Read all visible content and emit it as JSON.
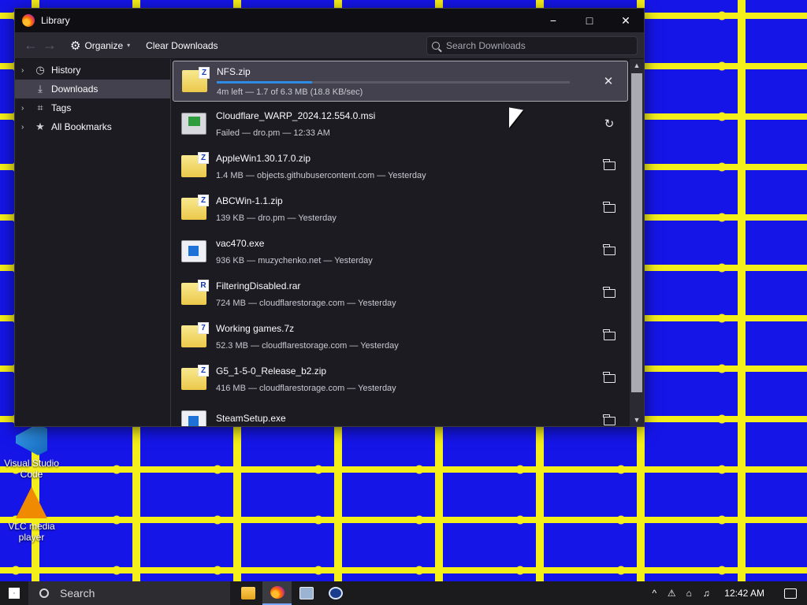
{
  "desktop": {
    "icons": [
      {
        "label": "Visual Studio Code",
        "icon": "vscode-icon"
      },
      {
        "label": "VLC media player",
        "icon": "vlc-icon"
      }
    ]
  },
  "window": {
    "title": "Library",
    "controls": {
      "minimize": "−",
      "maximize": "□",
      "close": "✕"
    }
  },
  "toolbar": {
    "back": "←",
    "forward": "→",
    "organize": "Organize",
    "clear_downloads": "Clear Downloads",
    "search_placeholder": "Search Downloads"
  },
  "sidebar": {
    "items": [
      {
        "label": "History",
        "icon": "clock-icon",
        "expandable": true,
        "active": false
      },
      {
        "label": "Downloads",
        "icon": "download-icon",
        "expandable": false,
        "active": true
      },
      {
        "label": "Tags",
        "icon": "tag-icon",
        "expandable": true,
        "active": false
      },
      {
        "label": "All Bookmarks",
        "icon": "star-icon",
        "expandable": true,
        "active": false
      }
    ]
  },
  "downloads": [
    {
      "name": "NFS.zip",
      "status": "4m left — 1.7 of 6.3 MB (18.8 KB/sec)",
      "progress": 0.27,
      "file_type": "zip",
      "action_icon": "cancel-icon"
    },
    {
      "name": "Cloudflare_WARP_2024.12.554.0.msi",
      "status": "Failed — dro.pm — 12:33 AM",
      "file_type": "msi",
      "action_icon": "retry-icon"
    },
    {
      "name": "AppleWin1.30.17.0.zip",
      "status": "1.4 MB — objects.githubusercontent.com — Yesterday",
      "file_type": "zip",
      "action_icon": "folder-icon"
    },
    {
      "name": "ABCWin-1.1.zip",
      "status": "139 KB — dro.pm — Yesterday",
      "file_type": "zip",
      "action_icon": "folder-icon"
    },
    {
      "name": "vac470.exe",
      "status": "936 KB — muzychenko.net — Yesterday",
      "file_type": "exe",
      "action_icon": "folder-icon"
    },
    {
      "name": "FilteringDisabled.rar",
      "status": "724 MB — cloudflarestorage.com — Yesterday",
      "file_type": "rar",
      "action_icon": "folder-icon"
    },
    {
      "name": "Working games.7z",
      "status": "52.3 MB — cloudflarestorage.com — Yesterday",
      "file_type": "7z",
      "action_icon": "folder-icon"
    },
    {
      "name": "G5_1-5-0_Release_b2.zip",
      "status": "416 MB — cloudflarestorage.com — Yesterday",
      "file_type": "zip",
      "action_icon": "folder-icon"
    },
    {
      "name": "SteamSetup.exe",
      "status": "",
      "file_type": "exe",
      "action_icon": "folder-icon"
    }
  ],
  "taskbar": {
    "search_text": "Search",
    "apps": [
      {
        "name": "file-explorer-icon",
        "active": false
      },
      {
        "name": "firefox-icon",
        "active": true
      },
      {
        "name": "network-app-icon",
        "active": false
      },
      {
        "name": "steam-icon",
        "active": false
      }
    ],
    "tray": {
      "chevron": "^",
      "clock": "12:42 AM"
    }
  },
  "colors": {
    "window_bg": "#1c1b22",
    "selected_item": "#42414d",
    "progress_accent": "#2c8ce6",
    "desktop_blue": "#1515e8",
    "desktop_yellow": "#f4ee1a"
  }
}
